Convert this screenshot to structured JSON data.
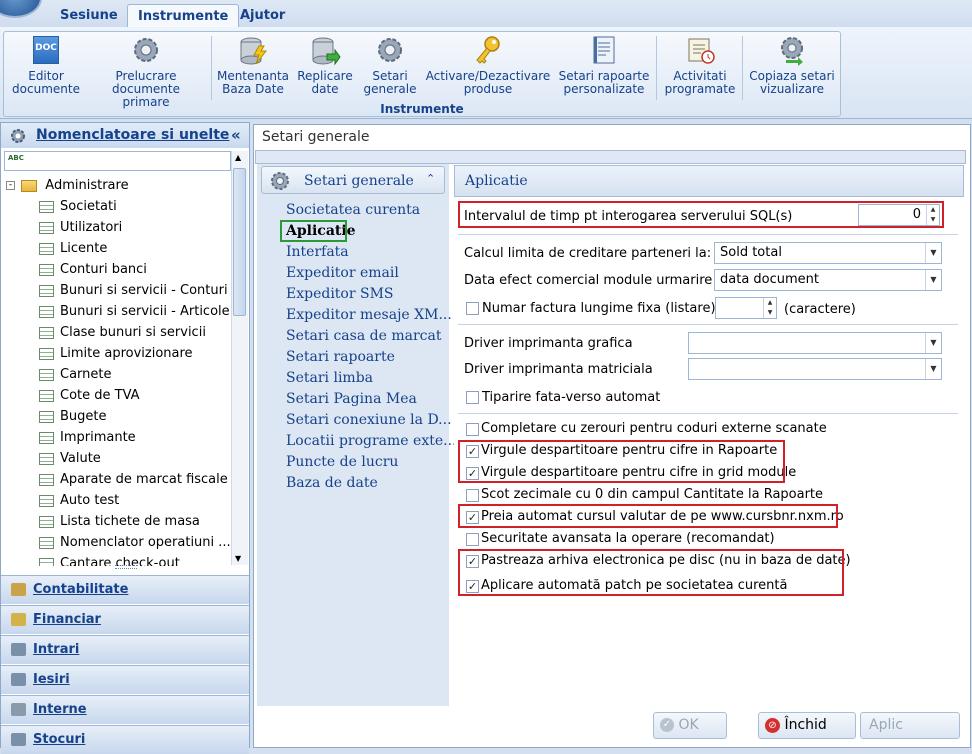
{
  "ribbon": {
    "tabs": [
      "Sesiune",
      "Instrumente",
      "Ajutor"
    ],
    "active_tab": "Instrumente",
    "buttons": [
      {
        "label1": "Editor",
        "label2": "documente",
        "icon": "doc-icon"
      },
      {
        "label1": "Prelucrare",
        "label2": "documente primare",
        "icon": "gear-icon"
      },
      {
        "label1": "Mentenanta",
        "label2": "Baza Date",
        "icon": "database-lightning-icon"
      },
      {
        "label1": "Replicare",
        "label2": "date",
        "icon": "database-arrow-icon"
      },
      {
        "label1": "Setari",
        "label2": "generale",
        "icon": "gear-icon"
      },
      {
        "label1": "Activare/Dezactivare",
        "label2": "produse",
        "icon": "key-icon"
      },
      {
        "label1": "Setari rapoarte",
        "label2": "personalizate",
        "icon": "report-icon"
      },
      {
        "label1": "Activitati",
        "label2": "programate",
        "icon": "calendar-icon"
      },
      {
        "label1": "Copiaza setari",
        "label2": "vizualizare",
        "icon": "gear-copy-icon"
      }
    ],
    "group_label": "Instrumente",
    "doc_icon_text": "DOC"
  },
  "left_panel": {
    "title": "Nomenclatoare si unelte",
    "collapse_glyph": "«",
    "search_icon_text": "ABC",
    "tree_root": "Administrare",
    "tree_items": [
      "Societati",
      "Utilizatori",
      "Licente",
      "Conturi banci",
      "Bunuri si servicii - Conturi",
      "Bunuri si servicii - Articole",
      "Clase bunuri si servicii",
      "Limite aprovizionare",
      "Carnete",
      "Cote de TVA",
      "Bugete",
      "Imprimante",
      "Valute",
      "Aparate de marcat fiscale",
      "Auto test",
      "Lista tichete de masa",
      "Nomenclator operatiuni ...",
      "Cantare check-out"
    ],
    "nav_buttons": [
      "Contabilitate",
      "Financiar",
      "Intrari",
      "Iesiri",
      "Interne",
      "Stocuri"
    ]
  },
  "content": {
    "title": "Setari generale",
    "nav_header": "Setari generale",
    "nav_links": [
      "Societatea curenta",
      "Aplicatie",
      "Interfata",
      "Expeditor email",
      "Expeditor SMS",
      "Expeditor mesaje XM...",
      "Setari casa de marcat",
      "Setari rapoarte",
      "Setari limba",
      "Setari Pagina Mea",
      "Setari conexiune la D...",
      "Locatii programe exte...",
      "Puncte de lucru",
      "Baza de date"
    ],
    "selected_link": "Aplicatie",
    "section_title": "Aplicatie",
    "sql_interval_label": "Intervalul de timp pt interogarea serverului SQL(s)",
    "sql_interval_value": "0",
    "credit_limit_label": "Calcul limita de creditare parteneri la:",
    "credit_limit_value": "Sold total",
    "effect_date_label": "Data efect comercial module urmarire",
    "effect_date_value": "data document",
    "invoice_fixed_label": "Numar factura lungime fixa (listare)",
    "invoice_fixed_checked": false,
    "invoice_length_value": "",
    "invoice_unit": "(caractere)",
    "graphic_printer_label": "Driver imprimanta grafica",
    "graphic_printer_value": "",
    "matrix_printer_label": "Driver imprimanta matriciala",
    "matrix_printer_value": "",
    "duplex_label": "Tiparire fata-verso automat",
    "duplex_checked": false,
    "options": [
      {
        "label": "Completare cu zerouri pentru coduri externe scanate",
        "checked": false
      },
      {
        "label": "Virgule despartitoare pentru cifre in Rapoarte",
        "checked": true
      },
      {
        "label": "Virgule despartitoare pentru cifre in grid module",
        "checked": true
      },
      {
        "label": "Scot zecimale cu 0 din campul Cantitate la Rapoarte",
        "checked": false
      },
      {
        "label": "Preia automat cursul valutar de pe www.cursbnr.nxm.ro",
        "checked": true
      },
      {
        "label": "Securitate avansata la operare (recomandat)",
        "checked": false
      },
      {
        "label": "Pastreaza arhiva electronica pe disc (nu in baza de date)",
        "checked": true
      },
      {
        "label": "Aplicare automată patch pe societatea curentă",
        "checked": true
      }
    ],
    "buttons": {
      "ok": "OK",
      "close": "Închid",
      "apply": "Aplic"
    }
  },
  "colors": {
    "accent": "#15428b",
    "highlight_red": "#d0202a",
    "highlight_green": "#2a9a35"
  }
}
